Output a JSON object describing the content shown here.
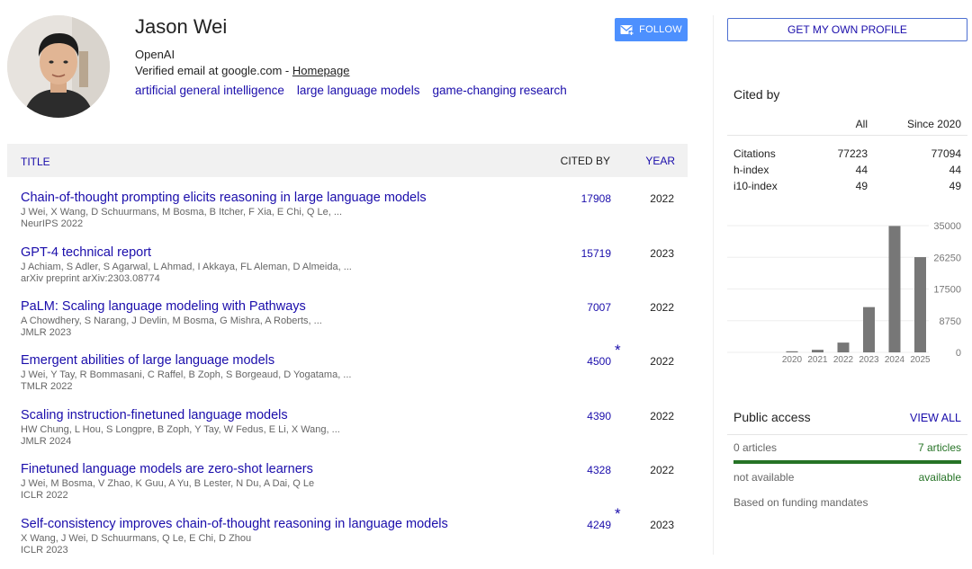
{
  "profile": {
    "name": "Jason Wei",
    "affiliation": "OpenAI",
    "email_text": "Verified email at google.com - ",
    "homepage_label": "Homepage",
    "interests": [
      "artificial general intelligence",
      "large language models",
      "game-changing research"
    ],
    "follow_label": "FOLLOW",
    "own_profile_label": "GET MY OWN PROFILE"
  },
  "table": {
    "title_header": "TITLE",
    "cited_header": "CITED BY",
    "year_header": "YEAR",
    "papers": [
      {
        "title": "Chain-of-thought prompting elicits reasoning in large language models",
        "authors": "J Wei, X Wang, D Schuurmans, M Bosma, B Itcher, F Xia, E Chi, Q Le, ...",
        "venue": "NeurIPS 2022",
        "cited": "17908",
        "star": "",
        "year": "2022"
      },
      {
        "title": "GPT-4 technical report",
        "authors": "J Achiam, S Adler, S Agarwal, L Ahmad, I Akkaya, FL Aleman, D Almeida, ...",
        "venue": "arXiv preprint arXiv:2303.08774",
        "cited": "15719",
        "star": "",
        "year": "2023"
      },
      {
        "title": "PaLM: Scaling language modeling with Pathways",
        "authors": "A Chowdhery, S Narang, J Devlin, M Bosma, G Mishra, A Roberts, ...",
        "venue": "JMLR 2023",
        "cited": "7007",
        "star": "",
        "year": "2022"
      },
      {
        "title": "Emergent abilities of large language models",
        "authors": "J Wei, Y Tay, R Bommasani, C Raffel, B Zoph, S Borgeaud, D Yogatama, ...",
        "venue": "TMLR 2022",
        "cited": "4500",
        "star": "*",
        "year": "2022"
      },
      {
        "title": "Scaling instruction-finetuned language models",
        "authors": "HW Chung, L Hou, S Longpre, B Zoph, Y Tay, W Fedus, E Li, X Wang, ...",
        "venue": "JMLR 2024",
        "cited": "4390",
        "star": "",
        "year": "2022"
      },
      {
        "title": "Finetuned language models are zero-shot learners",
        "authors": "J Wei, M Bosma, V Zhao, K Guu, A Yu, B Lester, N Du, A Dai, Q Le",
        "venue": "ICLR 2022",
        "cited": "4328",
        "star": "",
        "year": "2022"
      },
      {
        "title": "Self-consistency improves chain-of-thought reasoning in language models",
        "authors": "X Wang, J Wei, D Schuurmans, Q Le, E Chi, D Zhou",
        "venue": "ICLR 2023",
        "cited": "4249",
        "star": "*",
        "year": "2023"
      }
    ]
  },
  "cited_by": {
    "title": "Cited by",
    "col_all": "All",
    "col_since": "Since 2020",
    "rows": [
      {
        "label": "Citations",
        "all": "77223",
        "since": "77094"
      },
      {
        "label": "h-index",
        "all": "44",
        "since": "44"
      },
      {
        "label": "i10-index",
        "all": "49",
        "since": "49"
      }
    ]
  },
  "chart_data": {
    "type": "bar",
    "categories": [
      "2020",
      "2021",
      "2022",
      "2023",
      "2024",
      "2025"
    ],
    "values": [
      300,
      700,
      2700,
      12500,
      34900,
      26300
    ],
    "ylim": [
      0,
      35000
    ],
    "yticks": [
      "35000",
      "26250",
      "17500",
      "8750",
      "0"
    ],
    "title": "",
    "xlabel": "",
    "ylabel": "",
    "grid": true,
    "bar_color": "#777777"
  },
  "public_access": {
    "title": "Public access",
    "view_all": "VIEW ALL",
    "left_count": "0 articles",
    "right_count": "7 articles",
    "left_status": "not available",
    "right_status": "available",
    "available_fraction": 1.0,
    "note": "Based on funding mandates"
  },
  "colors": {
    "link": "#1a0dab",
    "follow_button": "#4d90fe",
    "available_green": "#267326"
  },
  "icons": {
    "follow": "mail-plus-icon",
    "avatar": "profile-photo"
  }
}
